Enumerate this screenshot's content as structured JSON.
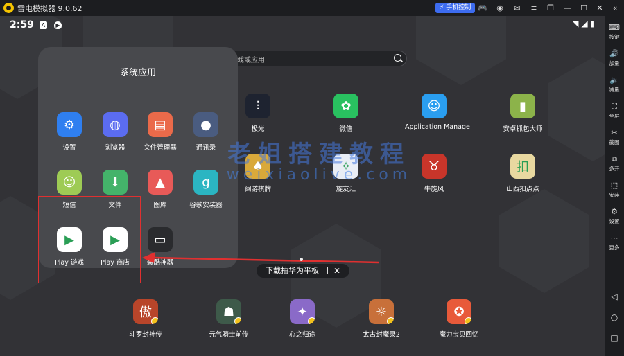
{
  "window": {
    "title": "雷电模拟器 9.0.62",
    "phone_control": "手机控制"
  },
  "status": {
    "time": "2:59"
  },
  "search": {
    "placeholder": "搜索游戏或应用"
  },
  "folder": {
    "title": "系统应用",
    "apps": [
      {
        "label": "设置",
        "icon": "gear-icon",
        "color": "#2f7ff0"
      },
      {
        "label": "浏览器",
        "icon": "globe-icon",
        "color": "#5b6cf0"
      },
      {
        "label": "文件管理器",
        "icon": "folder-icon",
        "color": "#ea6a4a"
      },
      {
        "label": "通讯录",
        "icon": "contact-icon",
        "color": "#4a5c80"
      },
      {
        "label": "短信",
        "icon": "sms-icon",
        "color": "#9ecb55"
      },
      {
        "label": "文件",
        "icon": "download-icon",
        "color": "#44b36a"
      },
      {
        "label": "图库",
        "icon": "gallery-icon",
        "color": "#e85a58"
      },
      {
        "label": "谷歌安装器",
        "icon": "g-icon",
        "color": "#2bb5c2"
      },
      {
        "label": "Play 游戏",
        "icon": "play-games-icon",
        "color": "#ffffff"
      },
      {
        "label": "Play 商店",
        "icon": "play-store-icon",
        "color": "#ffffff"
      },
      {
        "label": "装酷神器",
        "icon": "monitor-icon",
        "color": "#2a2b2e"
      }
    ]
  },
  "desktop_apps": [
    {
      "label": "极光",
      "icon": "aurora-icon",
      "color": "#1e2330"
    },
    {
      "label": "微信",
      "icon": "wechat-icon",
      "color": "#29c160"
    },
    {
      "label": "Application Manage",
      "icon": "app-manage-icon",
      "color": "#2a9ef0"
    },
    {
      "label": "安卓抓包大师",
      "icon": "capture-icon",
      "color": "#8cb34a"
    },
    {
      "label": "闽游棋牌",
      "icon": "cards-icon",
      "color": "#d9a93a"
    },
    {
      "label": "旋友汇",
      "icon": "xuanyou-icon",
      "color": "#e9edf5"
    },
    {
      "label": "牛旋风",
      "icon": "bull-icon",
      "color": "#c8352a"
    },
    {
      "label": "山西扣点点",
      "icon": "koudian-icon",
      "color": "#e8d8a0"
    }
  ],
  "page_indicator": "•",
  "tooltip": {
    "text": "下载抽华为平板",
    "close": "✕"
  },
  "dock": [
    {
      "label": "斗罗封神传",
      "icon": "douluo-icon",
      "color": "#b8452a"
    },
    {
      "label": "元气骑士前传",
      "icon": "soul-knight-icon",
      "color": "#3e5a4a"
    },
    {
      "label": "心之归途",
      "icon": "heart-path-icon",
      "color": "#8a6ac8"
    },
    {
      "label": "太古封魔录2",
      "icon": "taigu-icon",
      "color": "#c8703a"
    },
    {
      "label": "魔力宝贝回忆",
      "icon": "magic-baby-icon",
      "color": "#e85a3a"
    }
  ],
  "watermark": {
    "line1": "老姐搭建教程",
    "line2": "weixiaolive.com"
  },
  "sidebar": [
    {
      "label": "按键",
      "icon": "keyboard-icon"
    },
    {
      "label": "加量",
      "icon": "volume-up-icon"
    },
    {
      "label": "减量",
      "icon": "volume-down-icon"
    },
    {
      "label": "全屏",
      "icon": "fullscreen-icon"
    },
    {
      "label": "截图",
      "icon": "scissors-icon"
    },
    {
      "label": "多开",
      "icon": "multi-instance-icon"
    },
    {
      "label": "安装",
      "icon": "apk-icon"
    },
    {
      "label": "设置",
      "icon": "gear-icon"
    },
    {
      "label": "更多",
      "icon": "more-icon"
    }
  ]
}
